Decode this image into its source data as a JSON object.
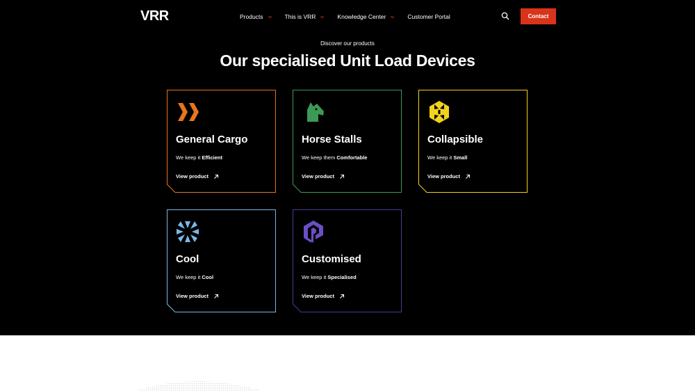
{
  "header": {
    "logo": "VRR",
    "nav": [
      {
        "label": "Products",
        "has_dropdown": true
      },
      {
        "label": "This is VRR",
        "has_dropdown": true
      },
      {
        "label": "Knowledge Center",
        "has_dropdown": true
      },
      {
        "label": "Customer Portal",
        "has_dropdown": false
      }
    ],
    "search_icon": "search-icon",
    "contact_label": "Contact"
  },
  "colors": {
    "accent": "#d9341b",
    "background": "#000000",
    "general_cargo": "#e8741e",
    "horse_stalls": "#3c9a56",
    "collapsible": "#f2d31b",
    "cool": "#7ab8e8",
    "customised": "#6b4fc4"
  },
  "section": {
    "eyebrow": "Discover our products",
    "heading": "Our specialised Unit Load Devices"
  },
  "cards": [
    {
      "title": "General Cargo",
      "tag_prefix": "We keep it ",
      "tag_bold": "Efficient",
      "link": "View product",
      "icon": "chevrons-icon"
    },
    {
      "title": "Horse Stalls",
      "tag_prefix": "We keep them ",
      "tag_bold": "Comfortable",
      "link": "View product",
      "icon": "horse-head-icon"
    },
    {
      "title": "Collapsible",
      "tag_prefix": "We keep it ",
      "tag_bold": "Small",
      "link": "View product",
      "icon": "collapse-arrows-icon"
    },
    {
      "title": "Cool",
      "tag_prefix": "We keep it ",
      "tag_bold": "Cool",
      "link": "View product",
      "icon": "snowflake-icon"
    },
    {
      "title": "Customised",
      "tag_prefix": "We keep it ",
      "tag_bold": "Specialised",
      "link": "View product",
      "icon": "custom-shape-icon"
    }
  ]
}
